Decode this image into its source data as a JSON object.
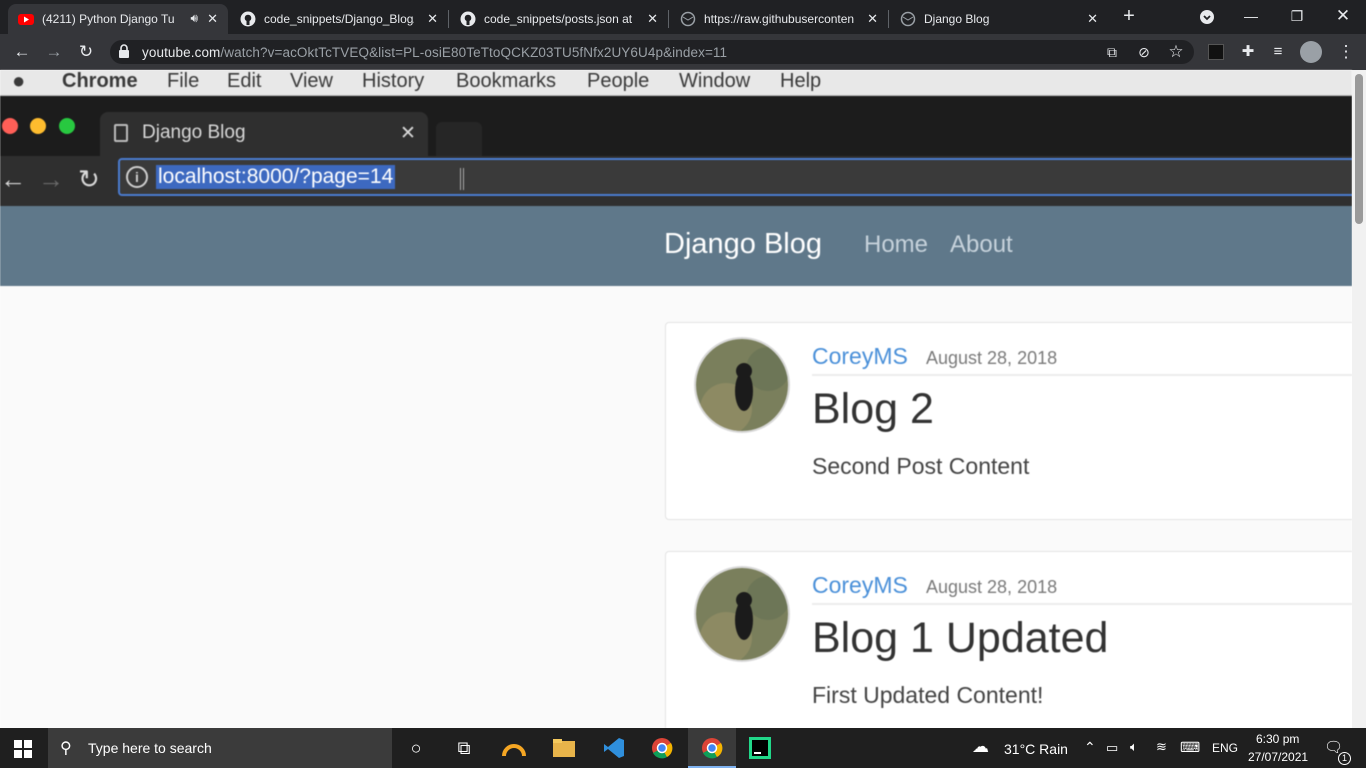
{
  "browser": {
    "tabs": [
      {
        "title": "(4211) Python Django Tu",
        "icon": "youtube-icon",
        "active": true
      },
      {
        "title": "code_snippets/Django_Blog/",
        "icon": "github-icon"
      },
      {
        "title": "code_snippets/posts.json at m",
        "icon": "github-icon"
      },
      {
        "title": "https://raw.githubuserconten",
        "icon": "globe-icon"
      },
      {
        "title": "Django Blog",
        "icon": "globe-icon"
      }
    ],
    "new_tab": "+",
    "address": {
      "host": "youtube.com",
      "path": "/watch?v=acOktTcTVEQ&list=PL-osiE80TeTtoQCKZ03TU5fNfx2UY6U4p&index=11"
    }
  },
  "video": {
    "mac_menu": [
      "Chrome",
      "File",
      "Edit",
      "View",
      "History",
      "Bookmarks",
      "People",
      "Window",
      "Help"
    ],
    "inner_tab_title": "Django Blog",
    "inner_url": "localhost:8000/?page=14",
    "site": {
      "brand": "Django Blog",
      "nav": [
        "Home",
        "About"
      ]
    },
    "posts": [
      {
        "author": "CoreyMS",
        "date": "August 28, 2018",
        "title": "Blog 2",
        "content": "Second Post Content"
      },
      {
        "author": "CoreyMS",
        "date": "August 28, 2018",
        "title": "Blog 1 Updated",
        "content": "First Updated Content!"
      }
    ]
  },
  "taskbar": {
    "search_placeholder": "Type here to search",
    "weather": "31°C  Rain",
    "language": "ENG",
    "time": "6:30 pm",
    "date": "27/07/2021",
    "notifications": "1"
  }
}
